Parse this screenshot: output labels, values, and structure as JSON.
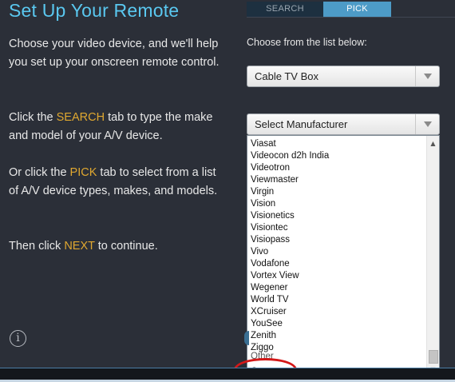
{
  "header": {
    "title": "Set Up Your Remote"
  },
  "tabs": [
    {
      "label": "SEARCH",
      "active": false
    },
    {
      "label": "PICK",
      "active": true
    }
  ],
  "instructions": {
    "p1": "Choose your video device, and we'll help you set up your onscreen remote control.",
    "p2_before": "Click the ",
    "p2_highlight": "SEARCH",
    "p2_after": " tab to type the make and model of your A/V device.",
    "p3_before": "Or click the ",
    "p3_highlight": "PICK",
    "p3_after": " tab to select from a list of A/V device types, makes, and models.",
    "p4_before": "Then click ",
    "p4_highlight": "NEXT",
    "p4_after": " to continue."
  },
  "picker": {
    "label": "Choose from the list below:",
    "device_type": "Cable TV Box",
    "manufacturer_placeholder": "Select Manufacturer",
    "manufacturer_options": [
      "Viasat",
      "Videocon d2h India",
      "Videotron",
      "Viewmaster",
      "Virgin",
      "Vision",
      "Visionetics",
      "Visiontec",
      "Visiopass",
      "Vivo",
      "Vodafone",
      "Vortex View",
      "Wegener",
      "World TV",
      "XCruiser",
      "YouSee",
      "Zenith",
      "Ziggo",
      "Other",
      "Custom"
    ]
  },
  "colors": {
    "background": "#2b2f38",
    "title": "#5ac8f0",
    "highlight": "#e0a830",
    "active_tab": "#4d9bc7",
    "annotation_circle": "#d41818"
  },
  "icons": {
    "info": "info-icon"
  }
}
